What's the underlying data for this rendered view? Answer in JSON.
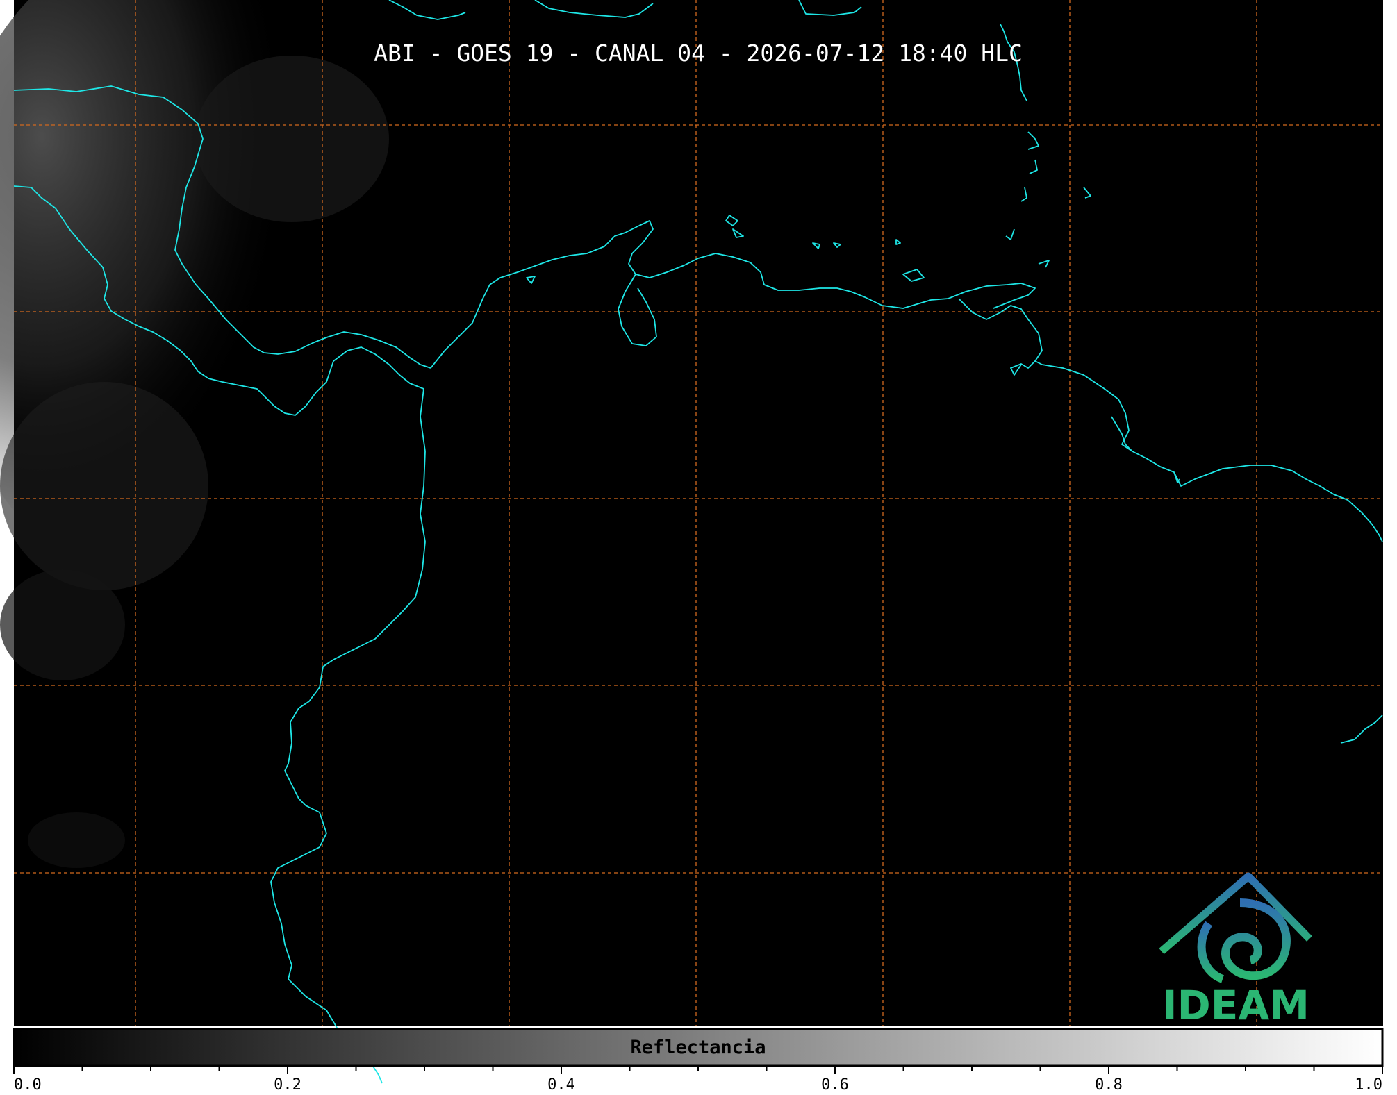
{
  "title": "ABI - GOES 19 - CANAL 04 - 2026-07-12 18:40 HLC",
  "logo": {
    "text": "IDEAM",
    "color_top": "#2f6fb3",
    "color_bottom": "#2bb673"
  },
  "colorbar": {
    "label": "Reflectancia",
    "range": [
      0.0,
      1.0
    ],
    "ticks": [
      "0.0",
      "0.2",
      "0.4",
      "0.6",
      "0.8",
      "1.0"
    ],
    "color_low": "#000000",
    "color_high": "#ffffff"
  },
  "map": {
    "background": "#000000",
    "coastline_color": "#1ee6e6",
    "gridline_color": "#d2691e",
    "gridlines": "dashed"
  }
}
